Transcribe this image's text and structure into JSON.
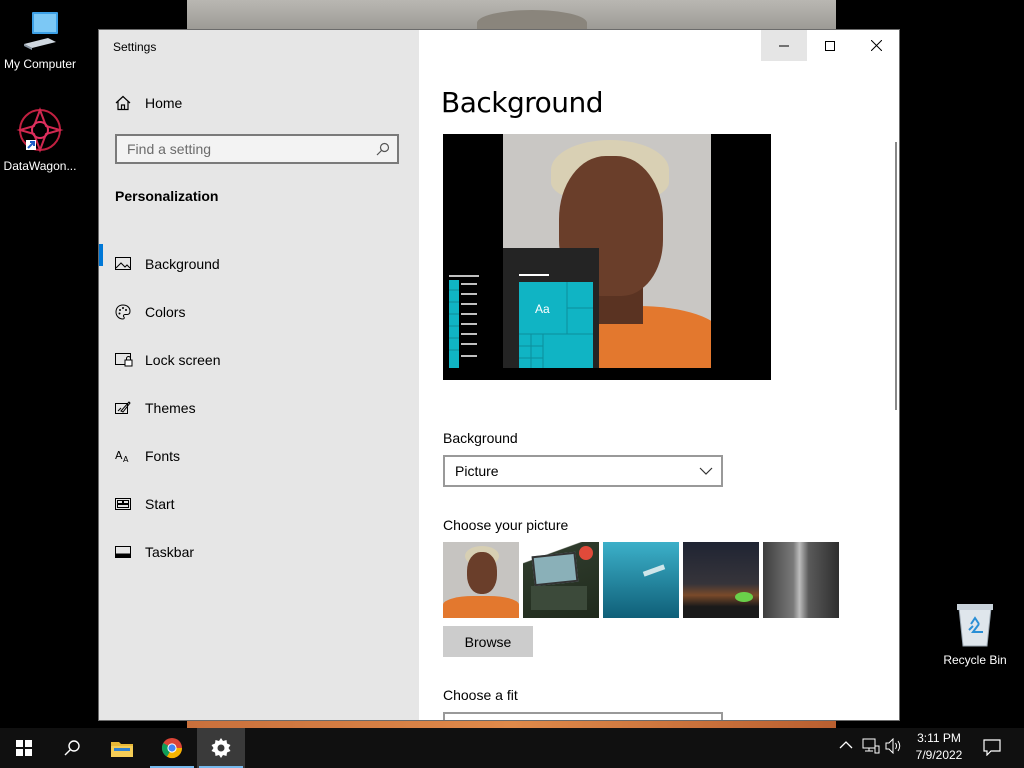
{
  "desktop": {
    "icons": [
      {
        "label": "My Computer"
      },
      {
        "label": "DataWagon..."
      },
      {
        "label": "Recycle Bin"
      }
    ]
  },
  "window": {
    "title": "Settings",
    "sidebar": {
      "home_label": "Home",
      "search_placeholder": "Find a setting",
      "section_heading": "Personalization",
      "items": [
        {
          "label": "Background",
          "icon": "picture-icon",
          "active": true
        },
        {
          "label": "Colors",
          "icon": "palette-icon"
        },
        {
          "label": "Lock screen",
          "icon": "lock-screen-icon"
        },
        {
          "label": "Themes",
          "icon": "themes-icon"
        },
        {
          "label": "Fonts",
          "icon": "fonts-icon"
        },
        {
          "label": "Start",
          "icon": "start-icon"
        },
        {
          "label": "Taskbar",
          "icon": "taskbar-icon"
        }
      ]
    },
    "content": {
      "page_title": "Background",
      "preview_tile_text": "Aa",
      "background_label": "Background",
      "background_value": "Picture",
      "choose_picture_label": "Choose your picture",
      "browse_label": "Browse",
      "choose_fit_label": "Choose a fit"
    }
  },
  "taskbar": {
    "time": "3:11 PM",
    "date": "7/9/2022"
  },
  "colors": {
    "accent": "#0078d7",
    "tile_accent": "#10b4c4",
    "sidebar_bg": "#e6e6e6",
    "taskbar_bg": "#101010"
  }
}
